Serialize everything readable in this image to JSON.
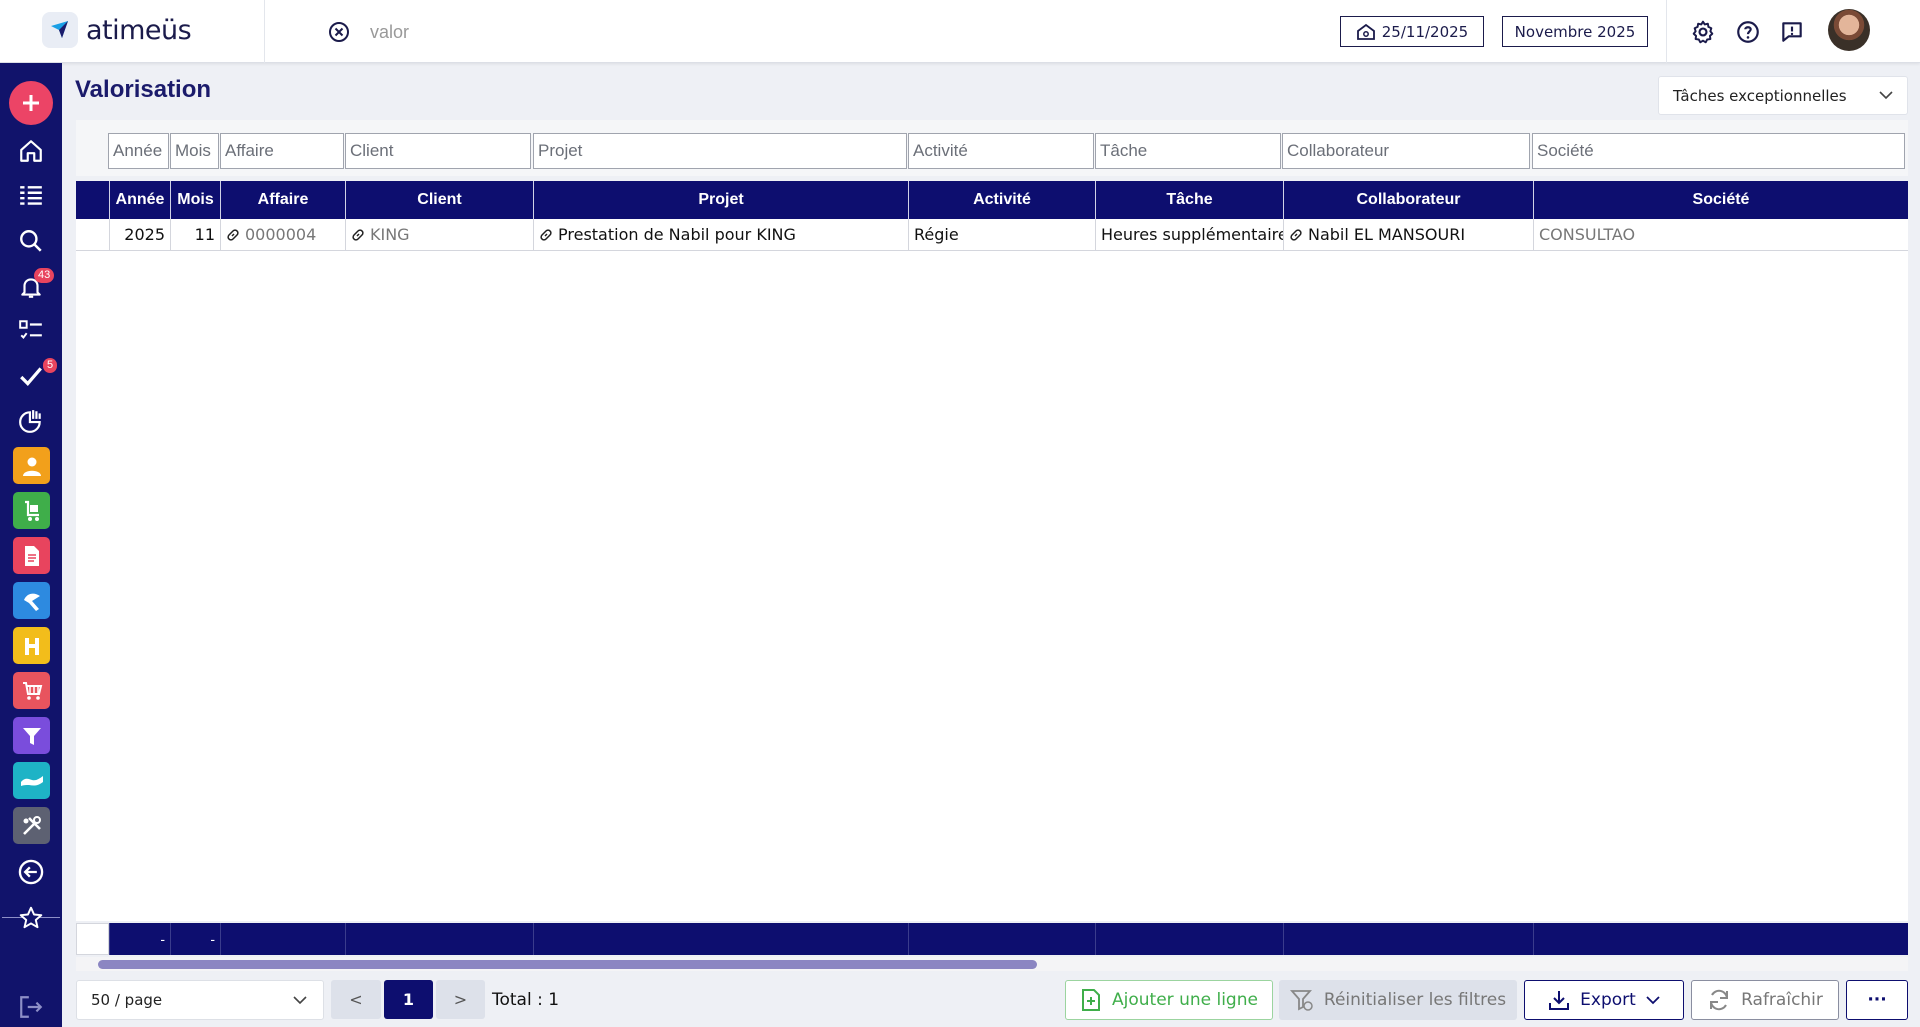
{
  "header": {
    "logo_text": "atimeüs",
    "search_value": "valor",
    "date": "25/11/2025",
    "month": "Novembre 2025"
  },
  "sidebar": {
    "notifications_badge": "43",
    "validations_badge": "5",
    "apps": [
      {
        "name": "users",
        "color": "#f2a01b"
      },
      {
        "name": "cart",
        "color": "#3fae4a"
      },
      {
        "name": "document",
        "color": "#e8445e"
      },
      {
        "name": "tools",
        "color": "#2d8ae0"
      },
      {
        "name": "building",
        "color": "#f2bd1b"
      },
      {
        "name": "shop",
        "color": "#e8545e"
      },
      {
        "name": "filter",
        "color": "#7a4ddc"
      },
      {
        "name": "handshake",
        "color": "#1eb3c6"
      },
      {
        "name": "settings-tools",
        "color": "#5d6172"
      }
    ]
  },
  "page": {
    "title": "Valorisation",
    "task_filter": "Tâches exceptionnelles"
  },
  "filters": {
    "annee": "Année",
    "mois": "Mois",
    "affaire": "Affaire",
    "client": "Client",
    "projet": "Projet",
    "activite": "Activité",
    "tache": "Tâche",
    "collaborateur": "Collaborateur",
    "societe": "Société"
  },
  "table": {
    "columns": [
      "Année",
      "Mois",
      "Affaire",
      "Client",
      "Projet",
      "Activité",
      "Tâche",
      "Collaborateur",
      "Société"
    ],
    "rows": [
      {
        "annee": "2025",
        "mois": "11",
        "affaire": "0000004",
        "client": "KING",
        "projet": "Prestation de Nabil pour KING",
        "activite": "Régie",
        "tache": "Heures supplémentaires",
        "collaborateur": "Nabil EL MANSOURI",
        "societe": "CONSULTAO"
      }
    ],
    "footer": {
      "annee": "-",
      "mois": "-"
    }
  },
  "pagination": {
    "page_size": "50 / page",
    "prev": "<",
    "current": "1",
    "next": ">",
    "total": "Total : 1"
  },
  "actions": {
    "add_line": "Ajouter une ligne",
    "reset_filters": "Réinitialiser les filtres",
    "export": "Export",
    "refresh": "Rafraîchir",
    "more": "···"
  },
  "colors": {
    "navy": "#0d0e6f",
    "accent_pink": "#ec4466",
    "green": "#3fae4a"
  }
}
